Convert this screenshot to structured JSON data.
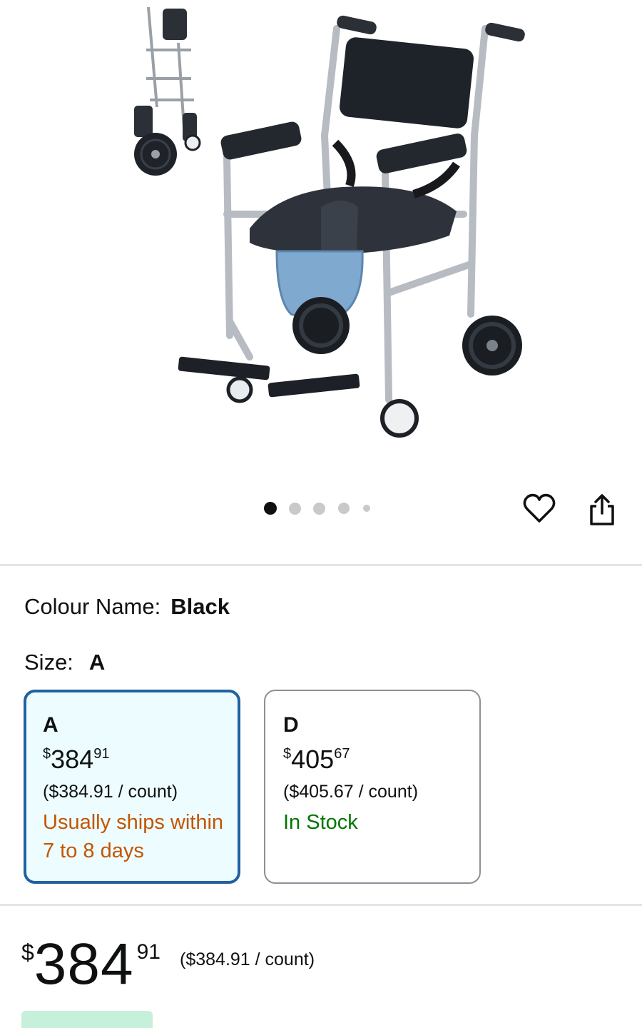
{
  "gallery": {
    "image_alt": "commode wheelchair",
    "dots": [
      {
        "active": true
      },
      {
        "active": false
      },
      {
        "active": false
      },
      {
        "active": false
      },
      {
        "active": false
      }
    ],
    "icons": {
      "favorite": "heart-icon",
      "share": "share-icon"
    }
  },
  "colour": {
    "label": "Colour Name:",
    "value": "Black"
  },
  "size": {
    "label": "Size:",
    "value": "A",
    "options": [
      {
        "name": "A",
        "price_symbol": "$",
        "price_whole": "384",
        "price_fraction": "91",
        "unit_price": "($384.91 / count)",
        "availability": "Usually ships within 7 to 8 days",
        "availability_color": "#c45500",
        "selected": true
      },
      {
        "name": "D",
        "price_symbol": "$",
        "price_whole": "405",
        "price_fraction": "67",
        "unit_price": "($405.67 / count)",
        "availability": "In Stock",
        "availability_color": "#007600",
        "selected": false
      }
    ]
  },
  "price": {
    "symbol": "$",
    "whole": "384",
    "fraction": "91",
    "unit_price": "($384.91 / count)"
  },
  "colors": {
    "selected_border": "#2162a1",
    "selected_bg": "#edfdff",
    "save_badge_bg": "#c6f0d9",
    "link": "#007185"
  }
}
